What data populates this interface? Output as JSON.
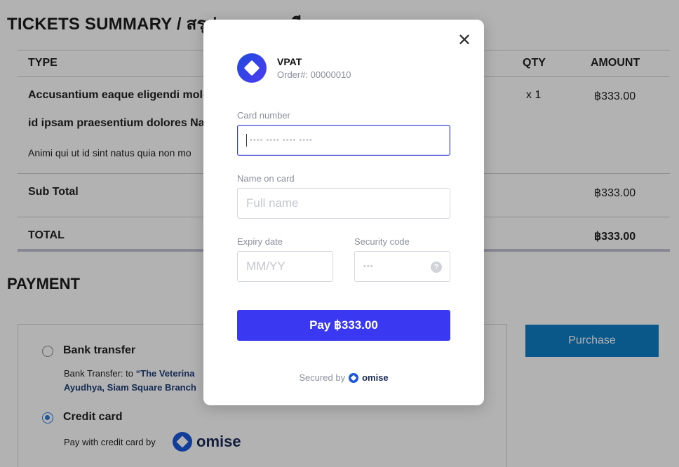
{
  "page": {
    "title": "TICKETS SUMMARY / สรุปการลงทะเบียน",
    "table": {
      "headers": {
        "type": "TYPE",
        "qty": "QTY",
        "amount": "AMOUNT"
      },
      "item": {
        "line1": "Accusantium eaque eligendi mole",
        "line2": "id ipsam praesentium dolores Na",
        "desc": "Animi qui ut id sint natus quia non mo",
        "qty": "x 1",
        "amount": "฿333.00"
      },
      "subtotal": {
        "label": "Sub Total",
        "amount": "฿333.00"
      },
      "total": {
        "label": "TOTAL",
        "amount": "฿333.00"
      }
    },
    "payment": {
      "heading": "PAYMENT",
      "bank": {
        "label": "Bank transfer",
        "desc_prefix": "Bank Transfer: to",
        "desc_bold": "“The Veterina",
        "desc_line2": "Ayudhya, Siam Square Branch"
      },
      "credit": {
        "label": "Credit card",
        "desc": "Pay with credit card by",
        "brand": "omise"
      },
      "purchase_label": "Purchase"
    }
  },
  "modal": {
    "merchant": "VPAT",
    "order": "Order#: 00000010",
    "card_number": {
      "label": "Card number",
      "placeholder": "•••• •••• •••• ••••"
    },
    "name_on_card": {
      "label": "Name on card",
      "placeholder": "Full name"
    },
    "expiry": {
      "label": "Expiry date",
      "placeholder": "MM/YY"
    },
    "security": {
      "label": "Security code",
      "placeholder": "•••",
      "help": "?"
    },
    "pay_label": "Pay ฿333.00",
    "secured_by": "Secured by",
    "secured_brand": "omise",
    "close": "✕"
  },
  "colors": {
    "pay_button": "#3b38f2",
    "purchase_button": "#0d7fc4",
    "radio_checked": "#2a7de1"
  }
}
